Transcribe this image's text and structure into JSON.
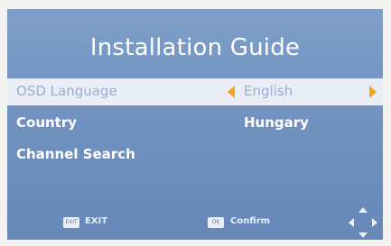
{
  "title": "Installation Guide",
  "menu": [
    {
      "label": "OSD Language",
      "value": "English",
      "selected": true
    },
    {
      "label": "Country",
      "value": "Hungary",
      "selected": false
    },
    {
      "label": "Channel Search",
      "value": "",
      "selected": false
    }
  ],
  "footer": {
    "exit_key": "EXIT",
    "exit_label": "EXIT",
    "ok_key": "OK",
    "ok_label": "Confirm"
  },
  "colors": {
    "background": "#7393c1",
    "highlight": "#e9eef6",
    "arrow": "#f3a21a"
  },
  "icons": {
    "left": "arrow-left-icon",
    "right": "arrow-right-icon",
    "nav": "dpad-icon"
  }
}
